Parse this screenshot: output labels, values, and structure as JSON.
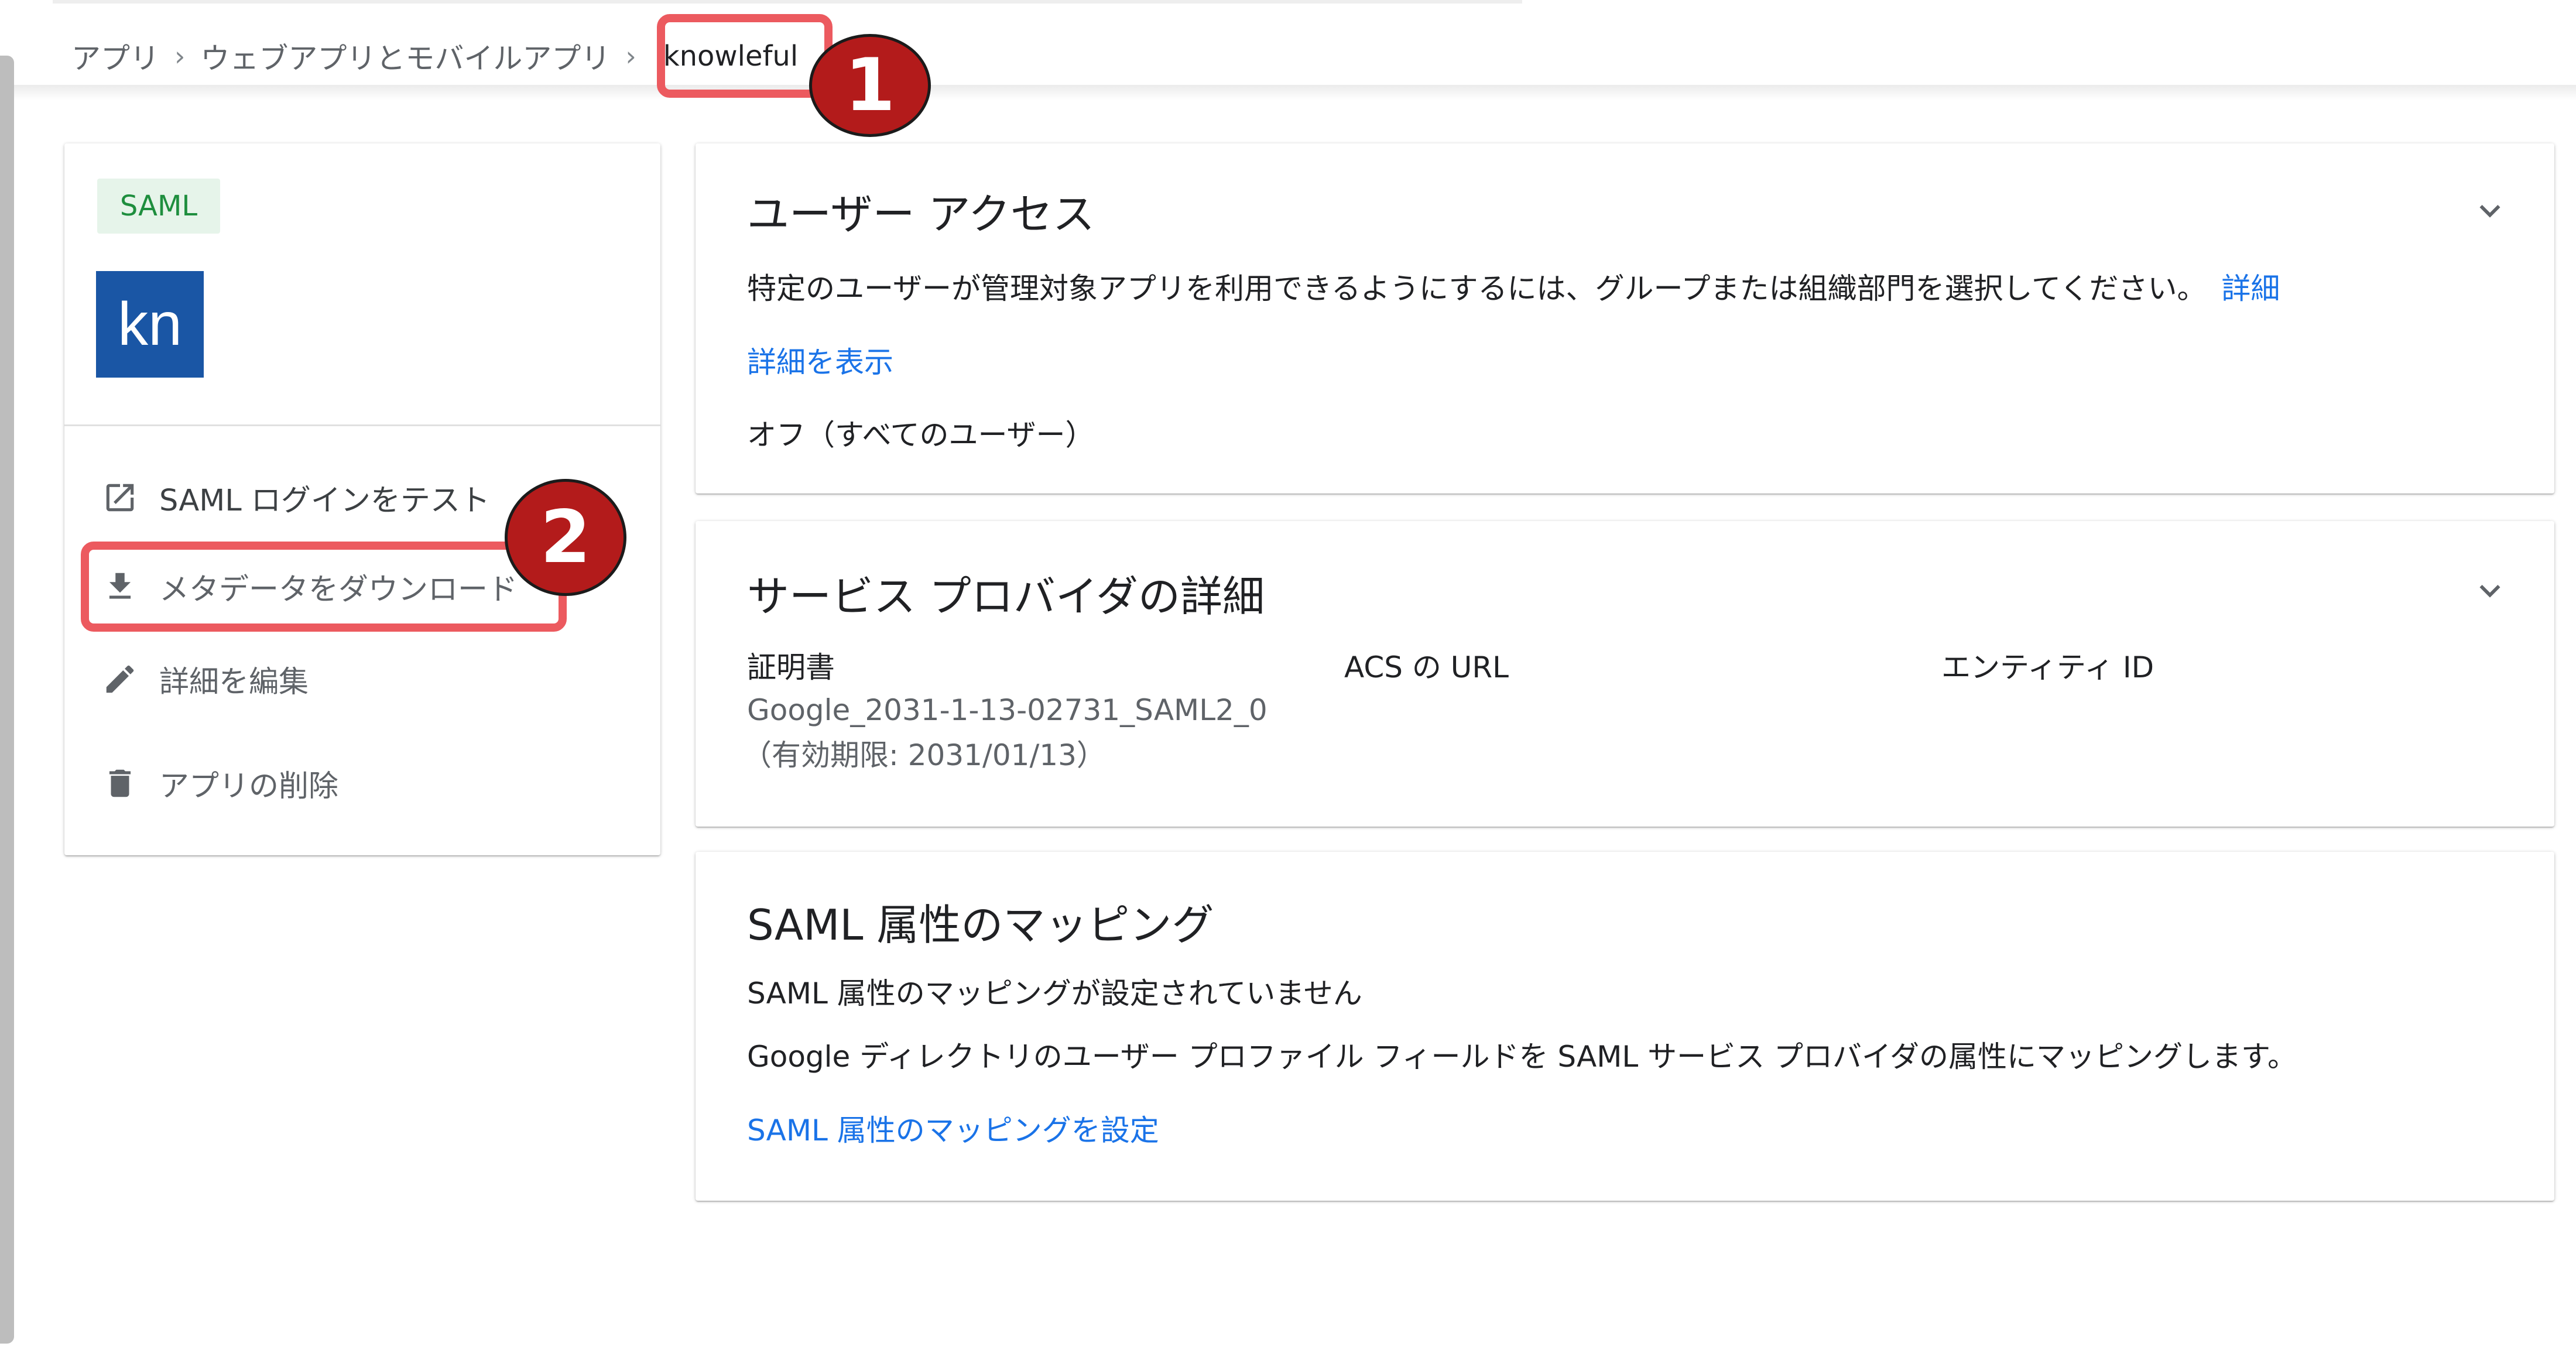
{
  "breadcrumb": {
    "items": [
      "アプリ",
      "ウェブアプリとモバイルアプリ"
    ],
    "separator": "›",
    "current": "knowleful"
  },
  "annotations": {
    "badge_1": "1",
    "badge_2": "2",
    "highlight_color": "#ec5a5f",
    "badge_color": "#b31b1b"
  },
  "app": {
    "type_chip": "SAML",
    "logo_text": "kn",
    "logo_color": "#1a56a5"
  },
  "actions": {
    "test_login": "SAML ログインをテスト",
    "download_metadata": "メタデータをダウンロード",
    "edit_details": "詳細を編集",
    "delete_app": "アプリの削除"
  },
  "user_access": {
    "title": "ユーザー アクセス",
    "description": "特定のユーザーが管理対象アプリを利用できるようにするには、グループまたは組織部門を選択してください。",
    "details_link": "詳細",
    "show_details_link": "詳細を表示",
    "status": "オフ（すべてのユーザー）"
  },
  "service_provider": {
    "title": "サービス プロバイダの詳細",
    "certificate_label": "証明書",
    "acs_url_label": "ACS の URL",
    "entity_id_label": "エンティティ ID",
    "certificate_name": "Google_2031-1-13-02731_SAML2_0",
    "certificate_expiry": "（有効期限: 2031/01/13）"
  },
  "attribute_mapping": {
    "title": "SAML 属性のマッピング",
    "not_configured": "SAML 属性のマッピングが設定されていません",
    "description": "Google ディレクトリのユーザー プロファイル フィールドを SAML サービス プロバイダの属性にマッピングします。",
    "configure_link": "SAML 属性のマッピングを設定"
  },
  "icons": {
    "test": "open-in-new-icon",
    "download": "download-icon",
    "edit": "pencil-icon",
    "delete": "trash-icon",
    "expand": "chevron-down-icon"
  }
}
